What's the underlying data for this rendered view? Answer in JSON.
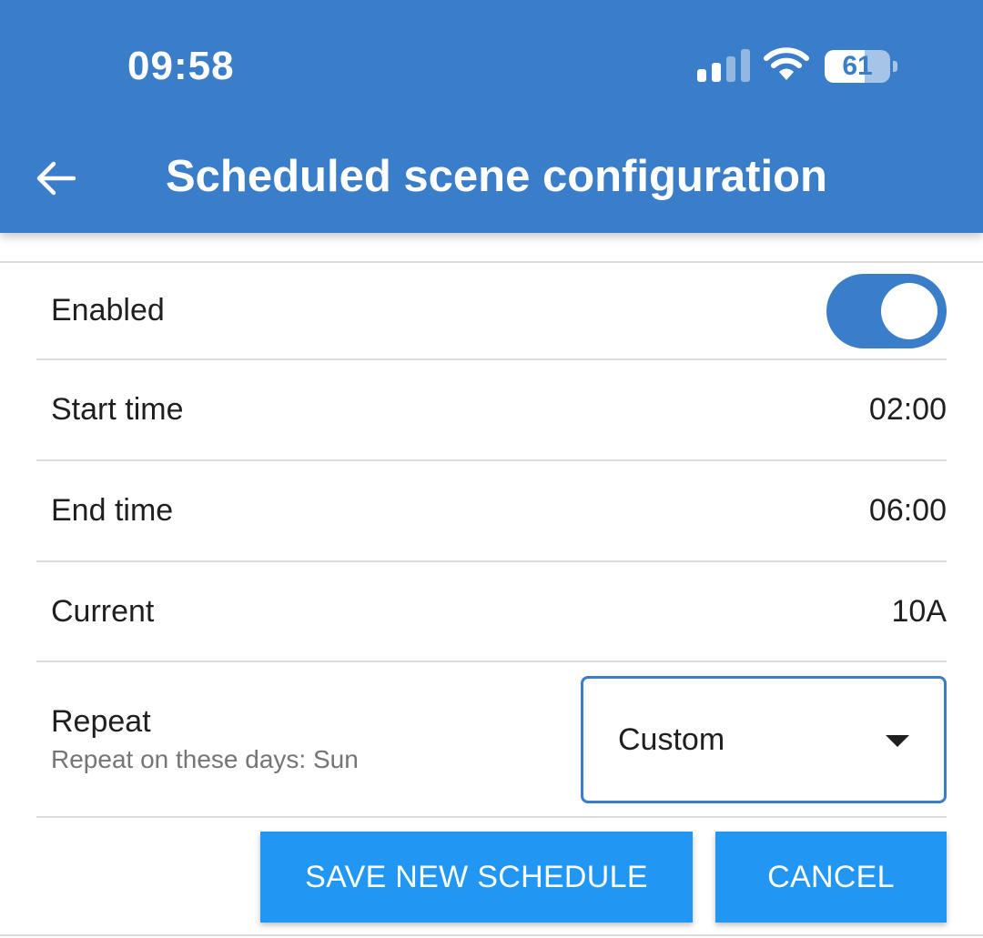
{
  "status_bar": {
    "time": "09:58",
    "battery_level": "61",
    "icons": [
      "cellular-signal-icon",
      "wifi-icon",
      "battery-icon"
    ]
  },
  "header": {
    "back_icon": "arrow-left-icon",
    "title": "Scheduled scene configuration"
  },
  "settings": {
    "enabled": {
      "label": "Enabled",
      "value": true
    },
    "start_time": {
      "label": "Start time",
      "value": "02:00"
    },
    "end_time": {
      "label": "End time",
      "value": "06:00"
    },
    "current": {
      "label": "Current",
      "value": "10A"
    },
    "repeat": {
      "label": "Repeat",
      "description": "Repeat on these days: Sun",
      "selected": "Custom"
    }
  },
  "actions": {
    "save_label": "SAVE NEW SCHEDULE",
    "cancel_label": "CANCEL"
  },
  "colors": {
    "primary": "#3a7dc8",
    "button": "#2196f3"
  }
}
